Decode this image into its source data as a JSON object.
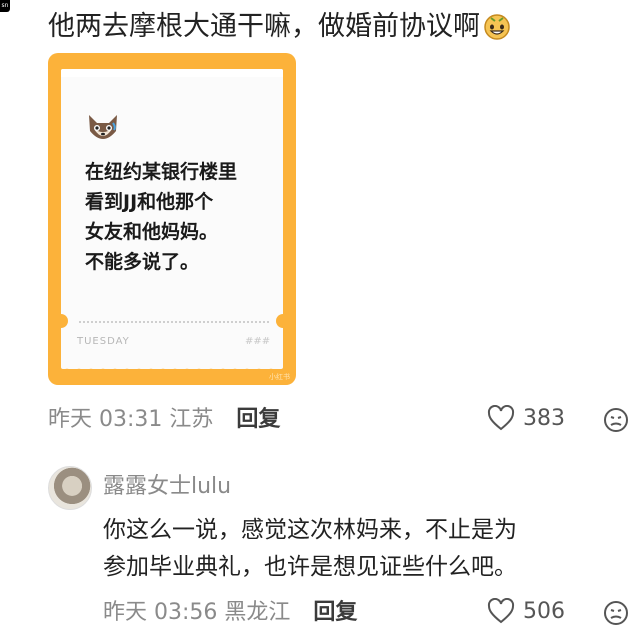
{
  "corner_tag": "sn",
  "comment1": {
    "text": "他两去摩根大通干嘛，做婚前协议啊",
    "emoji": "grin-emoji",
    "card": {
      "lines": [
        "在",
        "纽约",
        "某银行楼里",
        "看到JJ和他那个",
        "女友和他妈妈。",
        "不能多说了。"
      ],
      "day": "TUESDAY",
      "marks": "###",
      "watermark": "小红书"
    },
    "meta": {
      "time": "昨天 03:31",
      "location": "江苏",
      "reply": "回复",
      "likes": "383"
    }
  },
  "comment2": {
    "username": "露露女士lulu",
    "line1": "你这么一说，感觉这次林妈来，不止是为",
    "line2": "参加毕业典礼，也许是想见证些什么吧。",
    "meta": {
      "time": "昨天 03:56",
      "location": "黑龙江",
      "reply": "回复",
      "likes": "506"
    }
  },
  "colors": {
    "card": "#fcb23a",
    "highlight": "#9fd5f4"
  }
}
